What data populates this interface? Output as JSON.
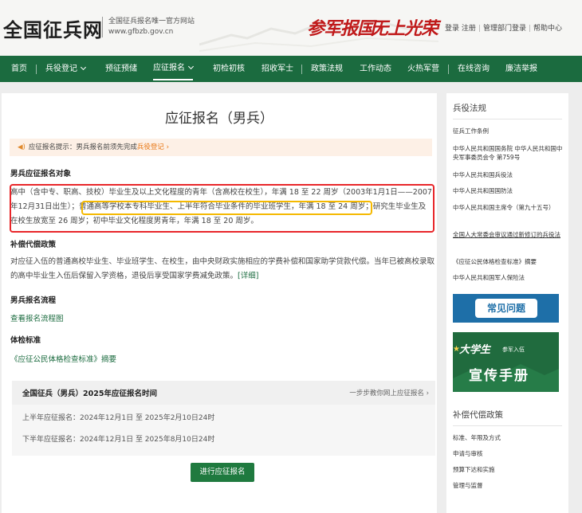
{
  "header": {
    "logo": "全国征兵网",
    "logo_sub1": "全国征兵报名唯一官方网站",
    "logo_sub2": "www.gfbzb.gov.cn",
    "slogan1": "参军报国",
    "slogan2": "无上光荣",
    "links": [
      "登录",
      "注册",
      "管理部门登录",
      "帮助中心"
    ]
  },
  "nav": {
    "items": [
      "首页",
      "兵役登记",
      "预征预储",
      "应征报名",
      "初检初核",
      "招收军士",
      "政策法规",
      "工作动态",
      "火热军营",
      "在线咨询",
      "廉洁举报"
    ],
    "active": "应征报名"
  },
  "main": {
    "title": "应征报名（男兵）",
    "tip_prefix": "应征报名提示：男兵报名前须先完成",
    "tip_link": "兵役登记 ›",
    "target_heading": "男兵应征报名对象",
    "target_line1": "高中（含中专、职高、技校）毕业生及以上文化程度的青年（含高校在校生），年满 18 至 22 周岁（2003年1月1日——2007",
    "target_line2_a": "年12月31日出生）；",
    "target_line2_highlight": "普通高等学校本专科毕业生、上半年符合毕业条件的毕业班学生，年满 18 至 24 周岁；",
    "target_line2_b": "研究生毕业生及",
    "target_line3": "在校生放宽至 26 周岁；初中毕业文化程度男青年，年满 18 至 20 周岁。",
    "comp_heading": "补偿代偿政策",
    "comp_text": "对应征入伍的普通高校毕业生、毕业班学生、在校生，由中央财政实施相应的学费补偿和国家助学贷款代偿。当年已被高校录取的高中毕业生入伍后保留入学资格，退役后享受国家学费减免政策。",
    "comp_link": "[详细]",
    "flow_heading": "男兵报名流程",
    "flow_link": "查看报名流程图",
    "physical_heading": "体检标准",
    "physical_link": "《应征公民体格检查标准》摘要",
    "time_title": "全国征兵（男兵）2025年应征报名时间",
    "time_guide": "一步步教你网上应征报名 ›",
    "time_first": "上半年应征报名：2024年12月1日 至 2025年2月10日24时",
    "time_second": "下半年应征报名：2024年12月1日 至 2025年8月10日24时",
    "apply_button": "进行应征报名"
  },
  "sidebar": {
    "law_heading": "兵役法规",
    "law_items": [
      "征兵工作条例",
      "中华人民共和国国务院 中华人民共和国中央军事委员会令 第759号",
      "中华人民共和国兵役法",
      "中华人民共和国国防法",
      "中华人民共和国主席令（第九十五号）",
      "全国人大常委会审议通过新修订的兵役法",
      "《应征公民体格检查标准》摘要",
      "中华人民共和国军人保险法"
    ],
    "faq_label": "常见问题",
    "handbook_big": "大学生",
    "handbook_small": "参军入伍",
    "handbook_sub": "宣传手册",
    "comp_heading": "补偿代偿政策",
    "comp_items": [
      "标准、年限及方式",
      "申请与审核",
      "预算下达和实施",
      "管理与监督"
    ]
  },
  "colors": {
    "nav_bg": "#1b6b3f",
    "red_slogan": "#c0191a",
    "red_box": "#e8262a",
    "yellow_box": "#f5b900",
    "tip_link": "#e87511"
  }
}
